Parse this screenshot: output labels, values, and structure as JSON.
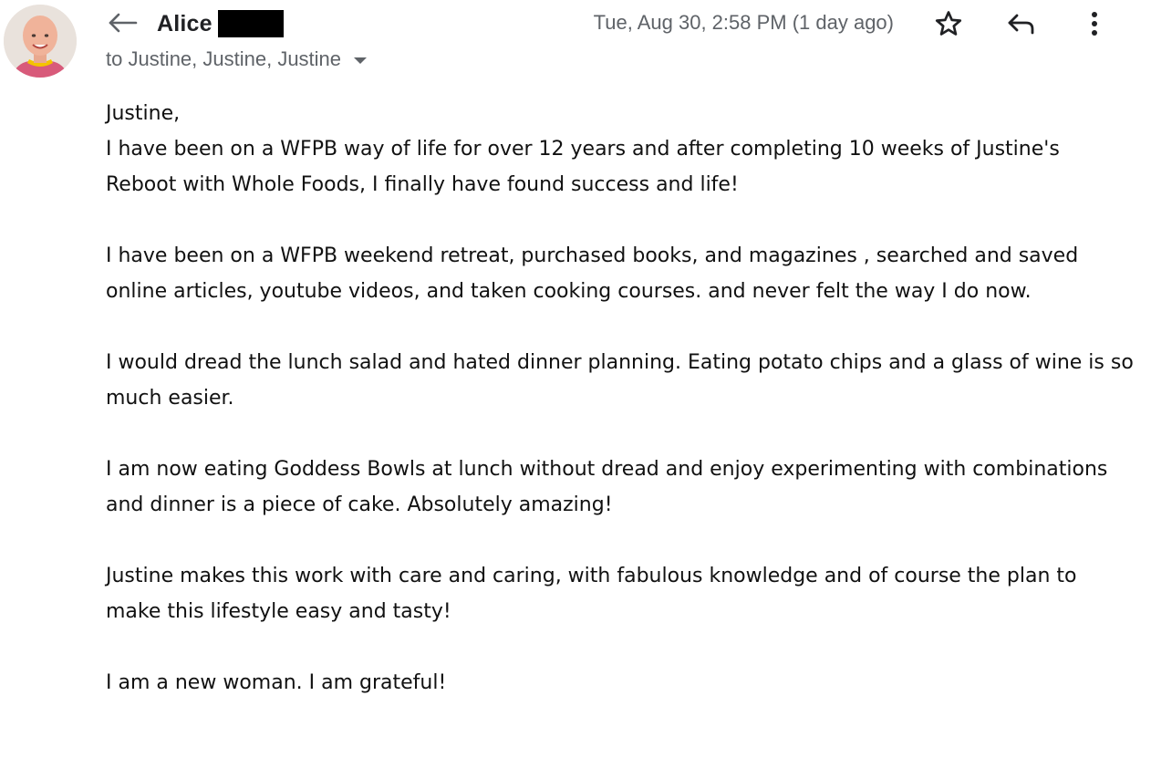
{
  "header": {
    "sender_name": "Alice",
    "recipients": "to Justine, Justine, Justine",
    "timestamp": "Tue, Aug 30, 2:58 PM (1 day ago)"
  },
  "icons": {
    "reply_indicator": "reply-arrow-icon",
    "star": "star-outline-icon",
    "reply": "reply-icon",
    "more": "more-vertical-icon",
    "recipients_dropdown": "chevron-down-icon"
  },
  "message": {
    "greeting": "Justine,",
    "paragraphs": [
      "I have been on a WFPB way of life for over 12 years and after completing 10 weeks of Justine's Reboot with Whole Foods, I finally have found success and life!",
      "I have been on a WFPB weekend retreat,  purchased books,  and magazines , searched and saved online articles, youtube videos, and taken cooking courses.  and never felt the way I do now.",
      "I would dread the lunch salad and hated dinner planning.  Eating potato chips and a glass of wine is so much easier.",
      "I am now eating Goddess Bowls at lunch without dread and enjoy experimenting with combinations and dinner is a piece of cake.  Absolutely amazing!",
      "Justine makes this work with care and caring, with fabulous knowledge and of course the plan to make this lifestyle easy and tasty!",
      "I am a new woman.  I am grateful!"
    ]
  },
  "colors": {
    "secondary_text": "#5f6368",
    "primary_text": "#202124",
    "body_text": "#111111",
    "redaction": "#000000"
  }
}
